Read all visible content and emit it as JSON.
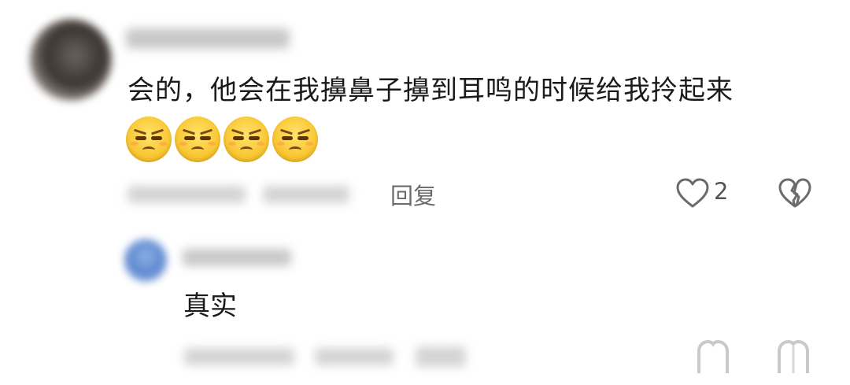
{
  "comment": {
    "text": "会的，他会在我擤鼻子擤到耳鸣的时候给我拎起来",
    "emoji_count": 4,
    "emoji_icon": "unamused-face-emoji",
    "reply_label": "回复",
    "like_count": "2",
    "like_icon": "heart-icon",
    "dislike_icon": "broken-heart-icon"
  },
  "reply": {
    "text": "真实"
  },
  "colors": {
    "text": "#1a1a1a",
    "muted": "#6b6b6b",
    "emoji": "#f8c22a"
  }
}
